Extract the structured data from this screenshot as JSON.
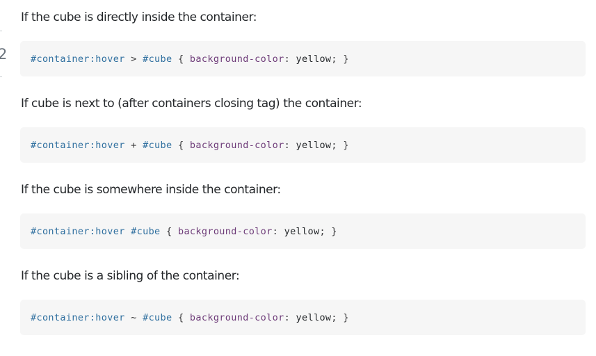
{
  "gutter": {
    "fragment": "2"
  },
  "colors": {
    "code_background": "#f6f6f6",
    "selector": "#2f6f9f",
    "property": "#6e3c79",
    "text": "#232629"
  },
  "sections": [
    {
      "text": "If the cube is directly inside the container:",
      "code": {
        "selector1": "#container",
        "pseudo": ":hover",
        "combinator": " > ",
        "selector2": "#cube",
        "open": " { ",
        "property": "background-color",
        "colon": ":",
        "value": " yellow",
        "close": "; }"
      }
    },
    {
      "text": "If cube is next to (after containers closing tag) the container:",
      "code": {
        "selector1": "#container",
        "pseudo": ":hover",
        "combinator": " + ",
        "selector2": "#cube",
        "open": " { ",
        "property": "background-color",
        "colon": ":",
        "value": " yellow",
        "close": "; }"
      }
    },
    {
      "text": "If the cube is somewhere inside the container:",
      "code": {
        "selector1": "#container",
        "pseudo": ":hover",
        "combinator": " ",
        "selector2": "#cube",
        "open": " { ",
        "property": "background-color",
        "colon": ":",
        "value": " yellow",
        "close": "; }"
      }
    },
    {
      "text": "If the cube is a sibling of the container:",
      "code": {
        "selector1": "#container",
        "pseudo": ":hover",
        "combinator": " ~ ",
        "selector2": "#cube",
        "open": " { ",
        "property": "background-color",
        "colon": ":",
        "value": " yellow",
        "close": "; }"
      }
    }
  ]
}
